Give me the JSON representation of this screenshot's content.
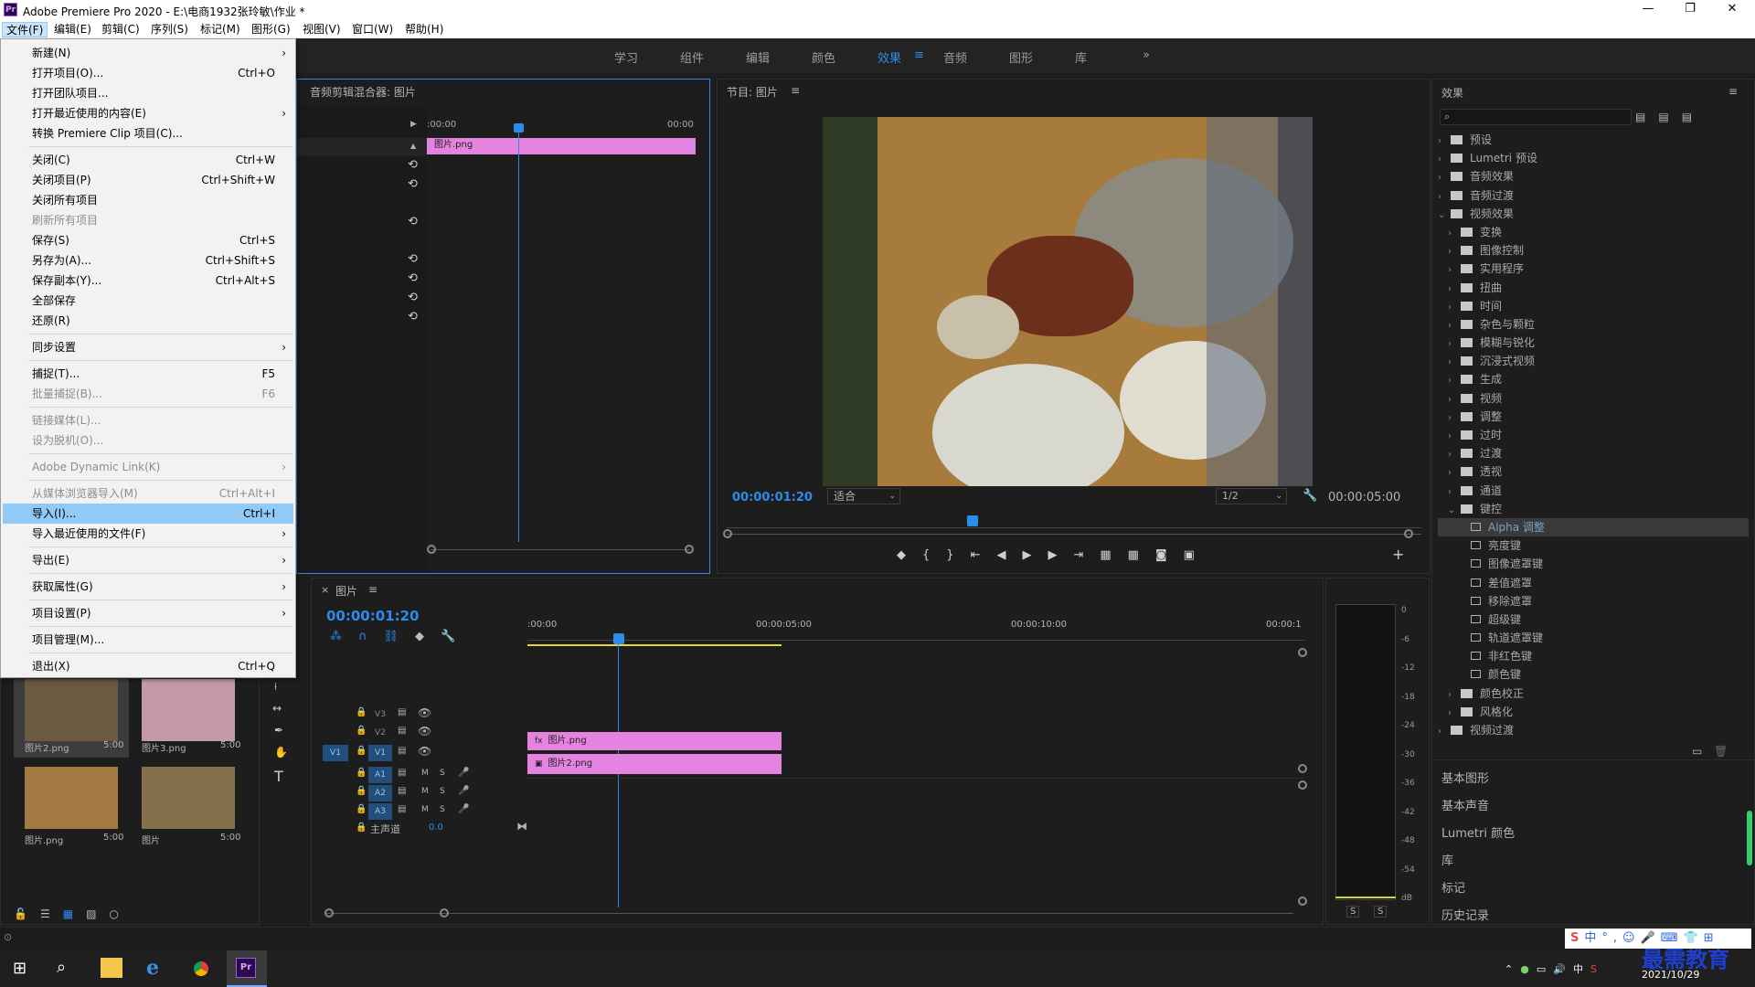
{
  "title_bar": {
    "app_badge": "Pr",
    "title": "Adobe Premiere Pro 2020 - E:\\电商1932张玲敏\\作业 *",
    "minimize": "—",
    "restore": "❐",
    "close": "✕"
  },
  "menu": [
    "文件(F)",
    "编辑(E)",
    "剪辑(C)",
    "序列(S)",
    "标记(M)",
    "图形(G)",
    "视图(V)",
    "窗口(W)",
    "帮助(H)"
  ],
  "workspaces": [
    "学习",
    "组件",
    "编辑",
    "颜色",
    "效果",
    "≡",
    "音频",
    "图形",
    "库",
    "»"
  ],
  "file_menu": [
    {
      "label": "新建(N)",
      "shortcut": "",
      "arrow": "›",
      "type": "item"
    },
    {
      "label": "打开项目(O)...",
      "shortcut": "Ctrl+O",
      "type": "item"
    },
    {
      "label": "打开团队项目...",
      "shortcut": "",
      "type": "item"
    },
    {
      "label": "打开最近使用的内容(E)",
      "shortcut": "",
      "arrow": "›",
      "type": "item"
    },
    {
      "label": "转换 Premiere Clip 项目(C)...",
      "shortcut": "",
      "type": "item"
    },
    {
      "type": "sep"
    },
    {
      "label": "关闭(C)",
      "shortcut": "Ctrl+W",
      "type": "item"
    },
    {
      "label": "关闭项目(P)",
      "shortcut": "Ctrl+Shift+W",
      "type": "item"
    },
    {
      "label": "关闭所有项目",
      "shortcut": "",
      "type": "item"
    },
    {
      "label": "刷新所有项目",
      "shortcut": "",
      "type": "item",
      "disabled": true
    },
    {
      "label": "保存(S)",
      "shortcut": "Ctrl+S",
      "type": "item"
    },
    {
      "label": "另存为(A)...",
      "shortcut": "Ctrl+Shift+S",
      "type": "item"
    },
    {
      "label": "保存副本(Y)...",
      "shortcut": "Ctrl+Alt+S",
      "type": "item"
    },
    {
      "label": "全部保存",
      "shortcut": "",
      "type": "item"
    },
    {
      "label": "还原(R)",
      "shortcut": "",
      "type": "item"
    },
    {
      "type": "sep"
    },
    {
      "label": "同步设置",
      "shortcut": "",
      "arrow": "›",
      "type": "item"
    },
    {
      "type": "sep"
    },
    {
      "label": "捕捉(T)...",
      "shortcut": "F5",
      "type": "item"
    },
    {
      "label": "批量捕捉(B)...",
      "shortcut": "F6",
      "type": "item",
      "disabled": true
    },
    {
      "type": "sep"
    },
    {
      "label": "链接媒体(L)...",
      "shortcut": "",
      "type": "item",
      "disabled": true
    },
    {
      "label": "设为脱机(O)...",
      "shortcut": "",
      "type": "item",
      "disabled": true
    },
    {
      "type": "sep"
    },
    {
      "label": "Adobe Dynamic Link(K)",
      "shortcut": "",
      "arrow": "›",
      "type": "item",
      "disabled": true
    },
    {
      "type": "sep"
    },
    {
      "label": "从媒体浏览器导入(M)",
      "shortcut": "Ctrl+Alt+I",
      "type": "item",
      "disabled": true
    },
    {
      "label": "导入(I)...",
      "shortcut": "Ctrl+I",
      "type": "item",
      "highlight": true
    },
    {
      "label": "导入最近使用的文件(F)",
      "shortcut": "",
      "arrow": "›",
      "type": "item"
    },
    {
      "type": "sep"
    },
    {
      "label": "导出(E)",
      "shortcut": "",
      "arrow": "›",
      "type": "item"
    },
    {
      "type": "sep"
    },
    {
      "label": "获取属性(G)",
      "shortcut": "",
      "arrow": "›",
      "type": "item"
    },
    {
      "type": "sep"
    },
    {
      "label": "项目设置(P)",
      "shortcut": "",
      "arrow": "›",
      "type": "item"
    },
    {
      "type": "sep"
    },
    {
      "label": "项目管理(M)...",
      "shortcut": "",
      "type": "item"
    },
    {
      "type": "sep"
    },
    {
      "label": "退出(X)",
      "shortcut": "Ctrl+Q",
      "type": "item"
    }
  ],
  "audio_mixer": {
    "title": "音频剪辑混合器: 图片",
    "time_start": ":00:00",
    "time_end": "00:00",
    "clip": "图片.png"
  },
  "program": {
    "title": "节目: 图片",
    "menu_icon": "≡",
    "timecode": "00:00:01:20",
    "fit": "适合",
    "quality": "1/2",
    "duration": "00:00:05:00"
  },
  "timeline": {
    "close": "×",
    "title": "图片",
    "menu_icon": "≡",
    "timecode": "00:00:01:20",
    "ruler": [
      ":00:00",
      "00:00:05:00",
      "00:00:10:00",
      "00:00:1"
    ],
    "tracks": [
      {
        "name": "V3",
        "target": ""
      },
      {
        "name": "V2",
        "target": ""
      },
      {
        "name": "V1",
        "target": "V1"
      },
      {
        "name": "A1",
        "target": ""
      },
      {
        "name": "A2",
        "target": ""
      },
      {
        "name": "A3",
        "target": ""
      }
    ],
    "master": {
      "label": "主声道",
      "value": "0.0"
    },
    "clips": {
      "v2": "图片.png",
      "v1": "图片2.png"
    },
    "mute_label": "M",
    "solo_label": "S"
  },
  "project": {
    "items": [
      {
        "name": "图片2.png",
        "dur": "5:00"
      },
      {
        "name": "图片3.png",
        "dur": "5:00"
      },
      {
        "name": "图片.png",
        "dur": "5:00"
      },
      {
        "name": "图片",
        "dur": "5:00"
      }
    ]
  },
  "effects": {
    "title": "效果",
    "menu_icon": "≡",
    "search_placeholder": "",
    "tree": [
      {
        "label": "预设",
        "depth": 0,
        "kind": "folder",
        "open": false
      },
      {
        "label": "Lumetri 预设",
        "depth": 0,
        "kind": "folder",
        "open": false
      },
      {
        "label": "音频效果",
        "depth": 0,
        "kind": "folder",
        "open": false
      },
      {
        "label": "音频过渡",
        "depth": 0,
        "kind": "folder",
        "open": false
      },
      {
        "label": "视频效果",
        "depth": 0,
        "kind": "folder",
        "open": true
      },
      {
        "label": "变换",
        "depth": 1,
        "kind": "folder",
        "open": false
      },
      {
        "label": "图像控制",
        "depth": 1,
        "kind": "folder",
        "open": false
      },
      {
        "label": "实用程序",
        "depth": 1,
        "kind": "folder",
        "open": false
      },
      {
        "label": "扭曲",
        "depth": 1,
        "kind": "folder",
        "open": false
      },
      {
        "label": "时间",
        "depth": 1,
        "kind": "folder",
        "open": false
      },
      {
        "label": "杂色与颗粒",
        "depth": 1,
        "kind": "folder",
        "open": false
      },
      {
        "label": "模糊与锐化",
        "depth": 1,
        "kind": "folder",
        "open": false
      },
      {
        "label": "沉浸式视频",
        "depth": 1,
        "kind": "folder",
        "open": false
      },
      {
        "label": "生成",
        "depth": 1,
        "kind": "folder",
        "open": false
      },
      {
        "label": "视频",
        "depth": 1,
        "kind": "folder",
        "open": false
      },
      {
        "label": "调整",
        "depth": 1,
        "kind": "folder",
        "open": false
      },
      {
        "label": "过时",
        "depth": 1,
        "kind": "folder",
        "open": false
      },
      {
        "label": "过渡",
        "depth": 1,
        "kind": "folder",
        "open": false
      },
      {
        "label": "透视",
        "depth": 1,
        "kind": "folder",
        "open": false
      },
      {
        "label": "通道",
        "depth": 1,
        "kind": "folder",
        "open": false
      },
      {
        "label": "键控",
        "depth": 1,
        "kind": "folder",
        "open": true
      },
      {
        "label": "Alpha 调整",
        "depth": 2,
        "kind": "fx",
        "selected": true
      },
      {
        "label": "亮度键",
        "depth": 2,
        "kind": "fx"
      },
      {
        "label": "图像遮罩键",
        "depth": 2,
        "kind": "fx"
      },
      {
        "label": "差值遮罩",
        "depth": 2,
        "kind": "fx"
      },
      {
        "label": "移除遮罩",
        "depth": 2,
        "kind": "fx"
      },
      {
        "label": "超级键",
        "depth": 2,
        "kind": "fx"
      },
      {
        "label": "轨道遮罩键",
        "depth": 2,
        "kind": "fx"
      },
      {
        "label": "非红色键",
        "depth": 2,
        "kind": "fx"
      },
      {
        "label": "颜色键",
        "depth": 2,
        "kind": "fx"
      },
      {
        "label": "颜色校正",
        "depth": 1,
        "kind": "folder",
        "open": false
      },
      {
        "label": "风格化",
        "depth": 1,
        "kind": "folder",
        "open": false
      },
      {
        "label": "视频过渡",
        "depth": 0,
        "kind": "folder",
        "open": false
      }
    ],
    "sections": [
      "基本图形",
      "基本声音",
      "Lumetri 颜色",
      "库",
      "标记",
      "历史记录"
    ]
  },
  "meter": {
    "labels": [
      "0",
      "-6",
      "-12",
      "-18",
      "-24",
      "-30",
      "-36",
      "-42",
      "-48",
      "-54",
      "dB"
    ],
    "solo": [
      "S",
      "S"
    ]
  },
  "taskbar": {
    "time": "",
    "date": "2021/10/29",
    "ime": "中",
    "watermark": "最需教育"
  },
  "colors": {
    "accent": "#2d8ceb",
    "clip": "#e583e0",
    "highlight": "#91c9f7"
  }
}
